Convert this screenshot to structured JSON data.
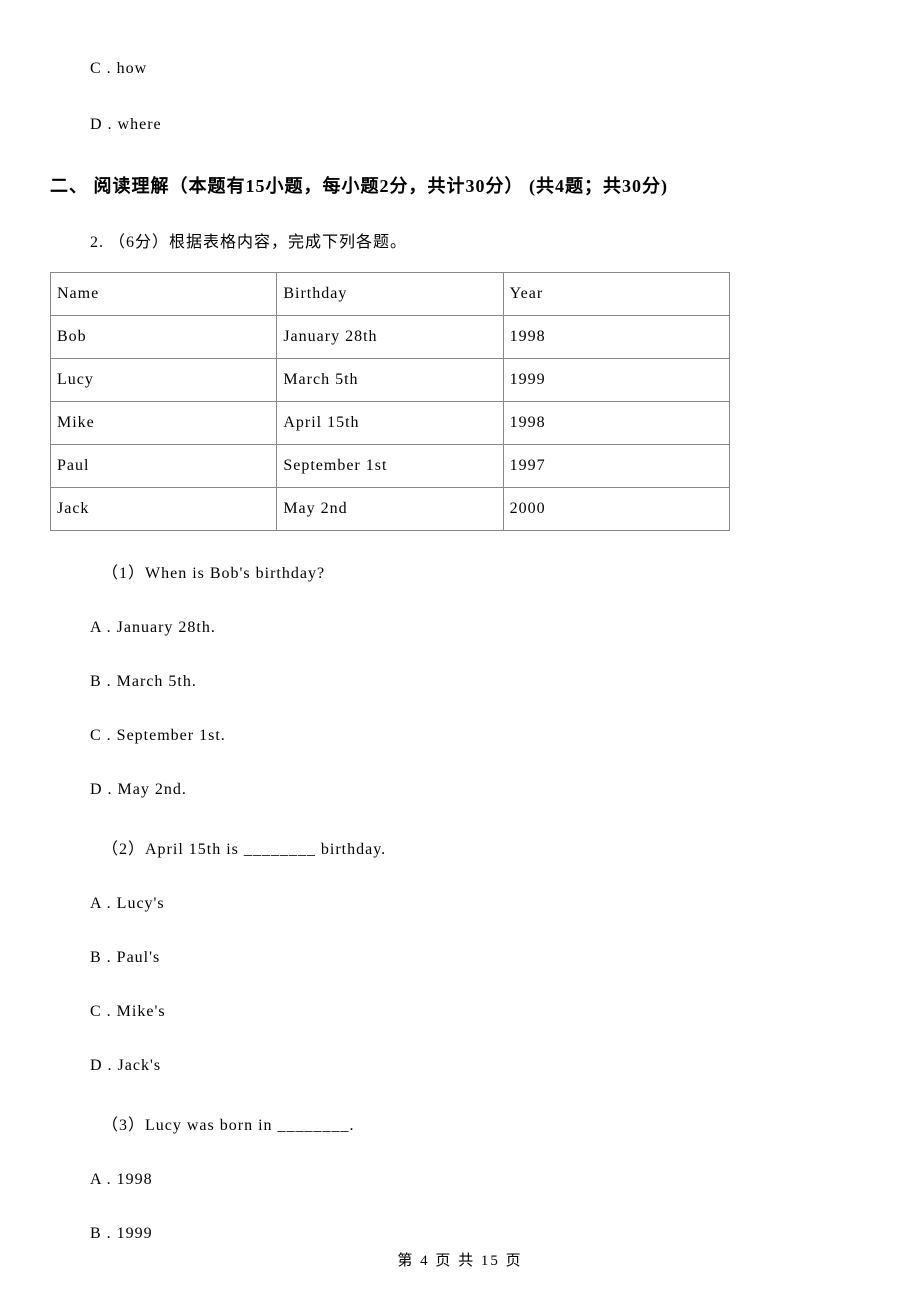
{
  "prev_options": {
    "c": "C . how",
    "d": "D . where"
  },
  "section_heading": "二、 阅读理解（本题有15小题，每小题2分，共计30分） (共4题；共30分)",
  "q2": {
    "intro": "2. （6分）根据表格内容，完成下列各题。",
    "table": {
      "headers": {
        "name": "Name",
        "birthday": "Birthday",
        "year": "Year"
      },
      "rows": [
        {
          "name": "Bob",
          "birthday": "January 28th",
          "year": "1998"
        },
        {
          "name": "Lucy",
          "birthday": "March 5th",
          "year": "1999"
        },
        {
          "name": "Mike",
          "birthday": "April 15th",
          "year": "1998"
        },
        {
          "name": "Paul",
          "birthday": "September 1st",
          "year": "1997"
        },
        {
          "name": "Jack",
          "birthday": "May 2nd",
          "year": "2000"
        }
      ]
    },
    "sub1": {
      "q": "（1）When is Bob's birthday?",
      "a": "A . January 28th.",
      "b": "B . March 5th.",
      "c": "C . September 1st.",
      "d": "D . May 2nd."
    },
    "sub2": {
      "q": "（2）April 15th is ________ birthday.",
      "a": "A . Lucy's",
      "b": "B . Paul's",
      "c": "C . Mike's",
      "d": "D . Jack's"
    },
    "sub3": {
      "q": "（3）Lucy was born in ________.",
      "a": "A . 1998",
      "b": "B . 1999"
    }
  },
  "footer": "第 4 页 共 15 页"
}
